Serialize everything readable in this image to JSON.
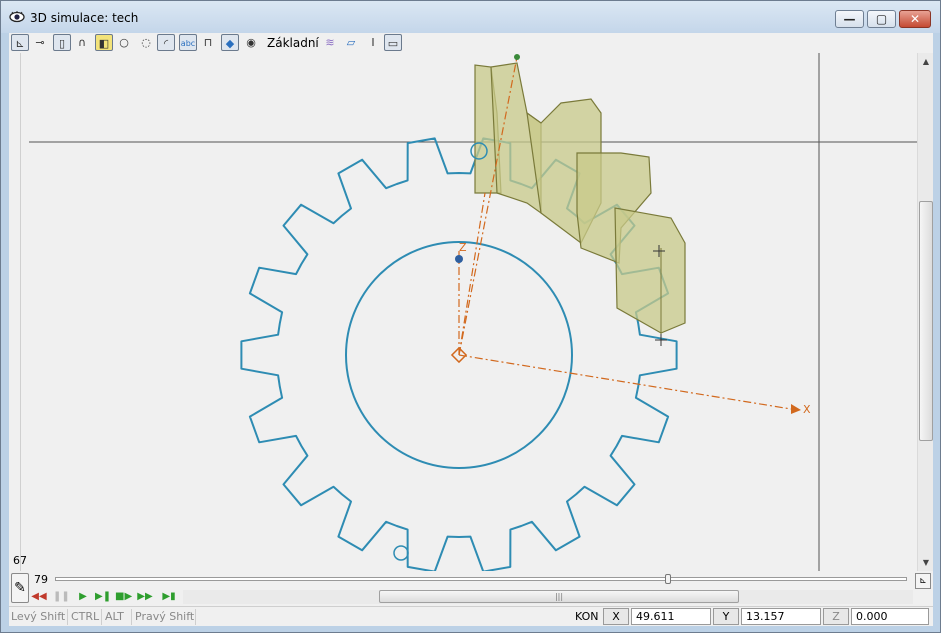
{
  "window": {
    "title": "3D simulace: tech",
    "min_glyph": "—",
    "max_glyph": "▢",
    "close_glyph": "✕"
  },
  "toolbar": {
    "view_label": "Základní"
  },
  "viewport": {
    "side_number": "67",
    "axis_x_label": "X",
    "axis_z_label": "Z",
    "colors": {
      "gear": "#2e8cb3",
      "axis": "#d2691e",
      "solid_fill": "#c8c98a",
      "solid_edge": "#7a7a3a",
      "crosshair": "#444444"
    }
  },
  "timeline": {
    "frame": "79",
    "position": 0.72
  },
  "status": {
    "keys": [
      "Levý Shift",
      "CTRL",
      "ALT",
      "Pravý Shift"
    ],
    "mode": "KON",
    "x_label": "X",
    "x_value": "49.611",
    "y_label": "Y",
    "y_value": "13.157",
    "z_label": "Z",
    "z_value": "0.000"
  }
}
